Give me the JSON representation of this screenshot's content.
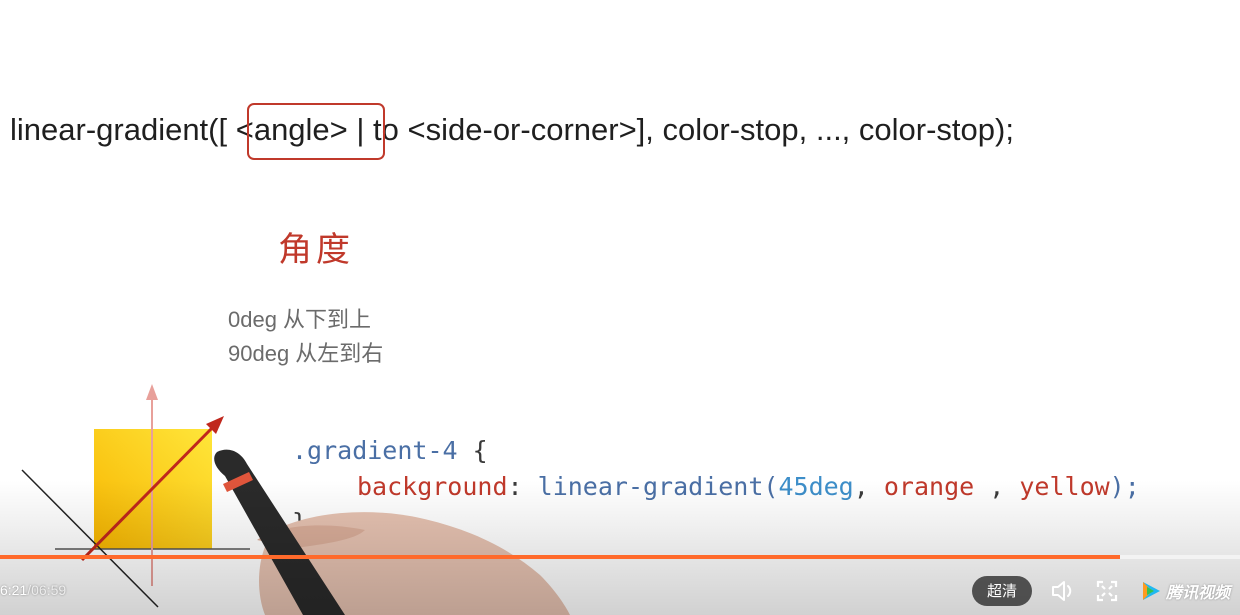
{
  "lesson": {
    "syntax_line": "linear-gradient([ <angle> | to <side-or-corner>], color-stop, ..., color-stop);",
    "angle_note": "角度",
    "deg_notes": [
      "0deg 从下到上",
      "90deg 从左到右"
    ],
    "code": {
      "selector": ".gradient-4",
      "open_brace": "{",
      "property": "background",
      "colon": ":",
      "function": "linear-gradient(",
      "angle_value": "45deg",
      "comma1": ",",
      "color1": "orange",
      "comma2": ",",
      "color2": "yellow",
      "close_paren": ");",
      "close_brace": "}"
    }
  },
  "player": {
    "current_time": "6:21",
    "separator": "/",
    "total_time": "06:59",
    "progress": 0.903,
    "quality_label": "超清",
    "brand": "腾讯视频",
    "accent_color": "#ff6a2b",
    "icons": [
      "volume-icon",
      "fullscreen-icon",
      "tencent-video-logo-icon"
    ]
  }
}
